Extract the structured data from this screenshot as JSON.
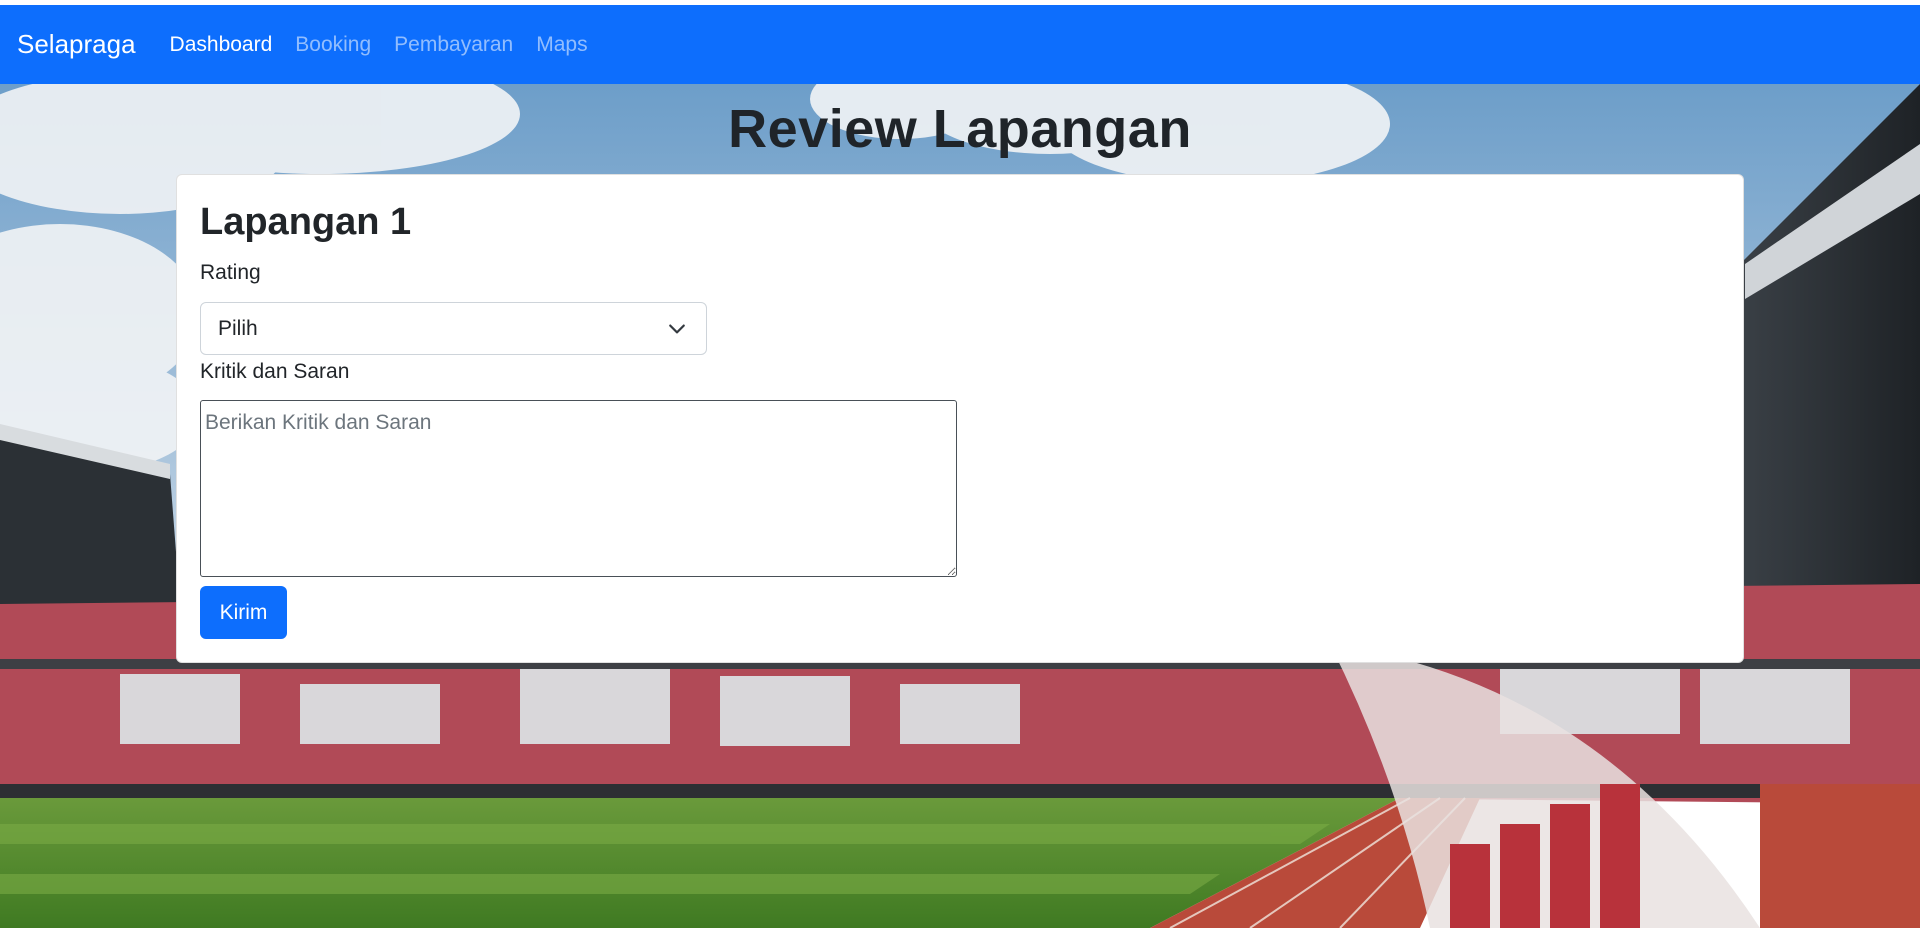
{
  "navbar": {
    "brand": "Selapraga",
    "links": [
      {
        "label": "Dashboard",
        "active": true
      },
      {
        "label": "Booking",
        "active": false
      },
      {
        "label": "Pembayaran",
        "active": false
      },
      {
        "label": "Maps",
        "active": false
      }
    ]
  },
  "page": {
    "title": "Review Lapangan"
  },
  "form": {
    "field_name": "Lapangan 1",
    "rating_label": "Rating",
    "rating_selected": "Pilih",
    "feedback_label": "Kritik dan Saran",
    "feedback_value": "",
    "feedback_placeholder": "Berikan Kritik dan Saran",
    "submit_label": "Kirim"
  },
  "colors": {
    "primary": "#0d6efd",
    "text": "#212529",
    "placeholder": "#6c757d"
  }
}
